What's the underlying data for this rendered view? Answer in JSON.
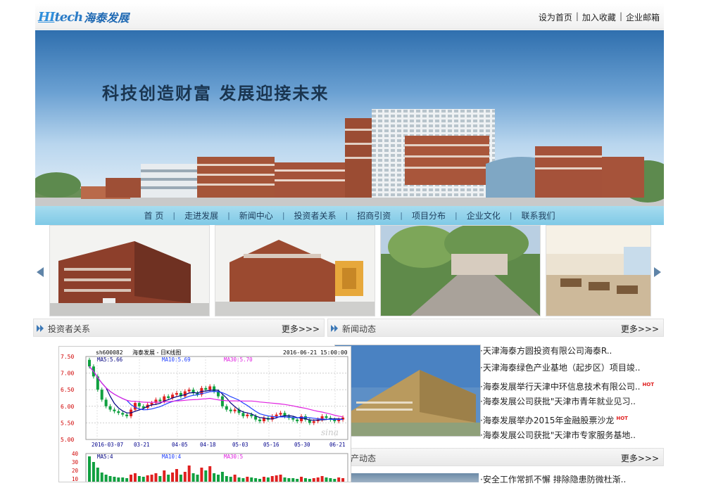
{
  "header": {
    "logo_en": "tech",
    "logo_mark": "HI",
    "logo_cn": "海泰发展",
    "links": [
      "设为首页",
      "加入收藏",
      "企业邮箱"
    ]
  },
  "banner": {
    "slogan": "科技创造财富 发展迎接未来"
  },
  "nav": [
    "首 页",
    "走进发展",
    "新闻中心",
    "投资者关系",
    "招商引资",
    "项目分布",
    "企业文化",
    "联系我们"
  ],
  "investor": {
    "title": "投资者关系",
    "more": "更多>>>"
  },
  "news": {
    "title": "新闻动态",
    "more": "更多>>>",
    "items": [
      {
        "text": "·天津海泰方圆投资有限公司海泰R..",
        "hot": ""
      },
      {
        "text": "·天津海泰绿色产业基地（起步区）项目竣..",
        "hot": ""
      },
      {
        "text": "·海泰发展举行天津中环信息技术有限公司..",
        "hot": "HOT"
      },
      {
        "text": "·海泰发展公司获批\"天津市青年就业见习..",
        "hot": ""
      },
      {
        "text": "·海泰发展举办2015年金融股票沙龙",
        "hot": "HOT"
      },
      {
        "text": "·海泰发展公司获批\"天津市专家服务基地..",
        "hot": ""
      }
    ]
  },
  "estate": {
    "title": "地产动态",
    "more": "更多>>>",
    "items": [
      {
        "text": "·安全工作常抓不懈 排除隐患防微杜渐..",
        "hot": ""
      }
    ]
  },
  "stock": {
    "code": "sh600082",
    "name": "海泰发展 - 日K线图",
    "datetime": "2016-06-21 15:00:00",
    "ma5": "MA5:5.66",
    "ma10": "MA10:5.69",
    "ma30": "MA30:5.70",
    "yticks": [
      "7.50",
      "7.00",
      "6.50",
      "6.00",
      "5.50",
      "5.00"
    ],
    "xticks": [
      "2016-03-07",
      "03-21",
      "04-05",
      "04-18",
      "05-03",
      "05-16",
      "05-30",
      "06-21"
    ],
    "vol_label": "MA5:4",
    "vol_ma10": "MA10:4",
    "vol_ma30": "MA30:5",
    "vol_yticks": [
      "40",
      "30",
      "20",
      "10"
    ],
    "watermark": "sina",
    "colors": {
      "up": "#e02020",
      "down": "#10a040",
      "ma5": "#000080",
      "ma10": "#2040ff",
      "ma30": "#e020e0"
    }
  }
}
